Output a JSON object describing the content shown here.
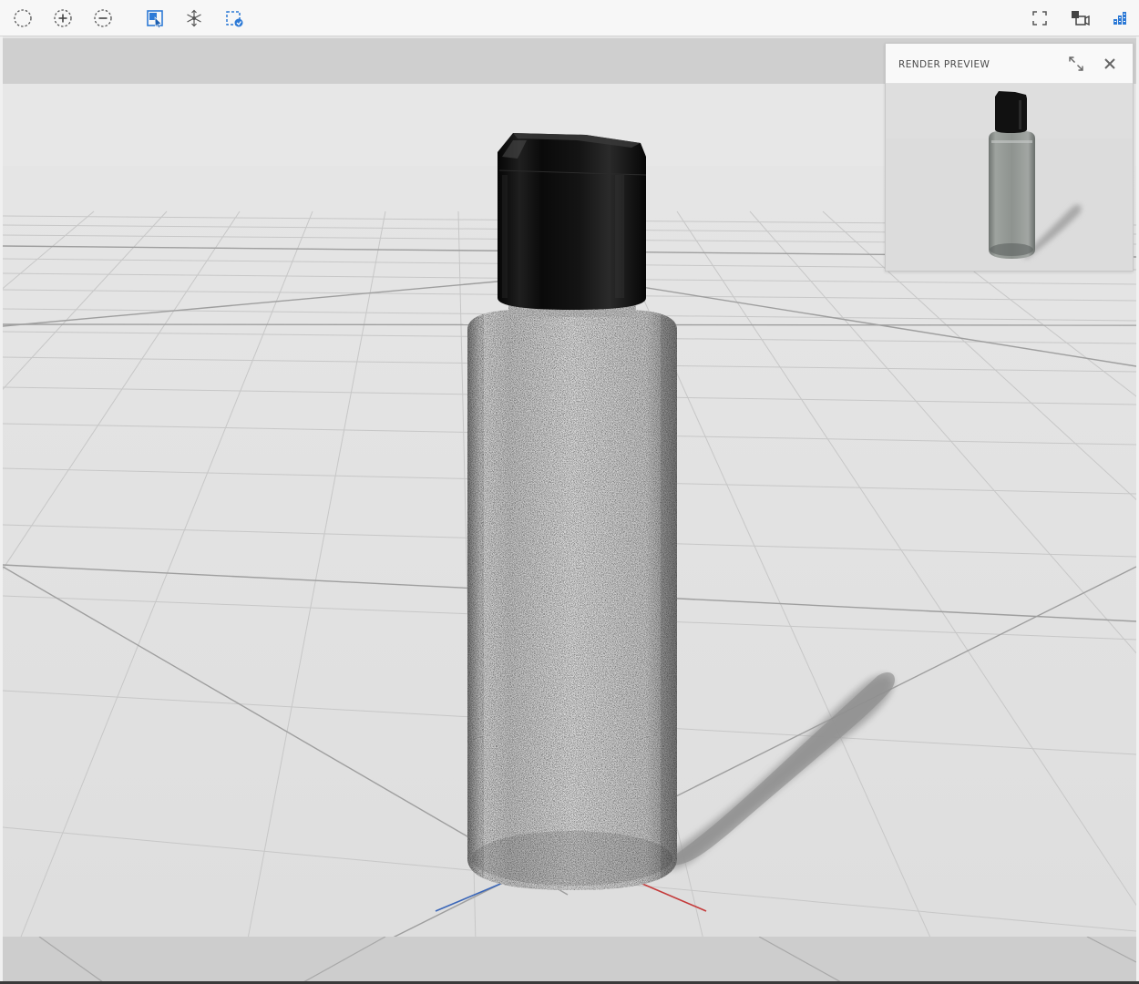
{
  "toolbar": {
    "left_tools": [
      {
        "icon": "select-circle-icon",
        "tooltip": ""
      },
      {
        "icon": "zoom-in-icon",
        "tooltip": ""
      },
      {
        "icon": "zoom-out-icon",
        "tooltip": ""
      },
      {
        "icon": "select-object-icon",
        "tooltip": ""
      },
      {
        "icon": "orbit-icon",
        "tooltip": ""
      },
      {
        "icon": "frame-select-icon",
        "tooltip": ""
      }
    ],
    "right_tools": [
      {
        "icon": "fullscreen-icon"
      },
      {
        "icon": "camera-view-icon"
      },
      {
        "icon": "render-quality-icon"
      }
    ],
    "accent_color": "#2d7ad6"
  },
  "preview": {
    "title": "RENDER PREVIEW",
    "expand_icon": "expand-icon",
    "close_icon": "close-icon"
  },
  "scene": {
    "object": "bottle",
    "cap_color": "#0d0d0d",
    "floor_color": "#e2e2e2",
    "axis_x_color": "#c43a3a",
    "axis_z_color": "#3a66b8"
  }
}
